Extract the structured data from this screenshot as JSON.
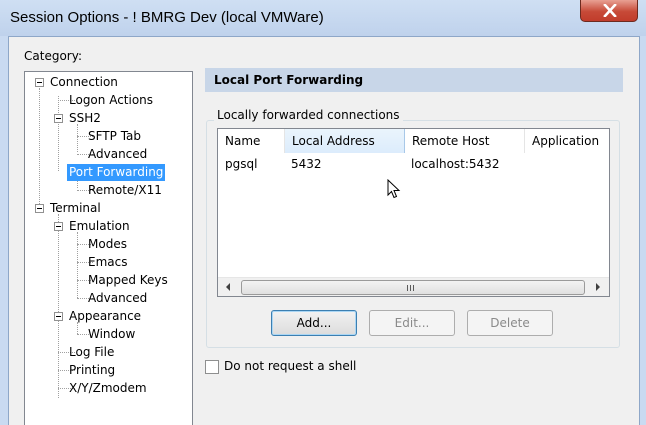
{
  "window": {
    "title": "Session Options - ! BMRG Dev (local VMWare)",
    "close_icon": "close-icon"
  },
  "category": {
    "label": "Category:",
    "tree": [
      {
        "label": "Connection",
        "level": 0
      },
      {
        "label": "Logon Actions",
        "level": 1
      },
      {
        "label": "SSH2",
        "level": 1
      },
      {
        "label": "SFTP Tab",
        "level": 2
      },
      {
        "label": "Advanced",
        "level": 2
      },
      {
        "label": "Port Forwarding",
        "level": 1,
        "selected": true
      },
      {
        "label": "Remote/X11",
        "level": 2
      },
      {
        "label": "Terminal",
        "level": 0
      },
      {
        "label": "Emulation",
        "level": 1
      },
      {
        "label": "Modes",
        "level": 2
      },
      {
        "label": "Emacs",
        "level": 2
      },
      {
        "label": "Mapped Keys",
        "level": 2
      },
      {
        "label": "Advanced",
        "level": 2
      },
      {
        "label": "Appearance",
        "level": 1
      },
      {
        "label": "Window",
        "level": 2
      },
      {
        "label": "Log File",
        "level": 1
      },
      {
        "label": "Printing",
        "level": 1
      },
      {
        "label": "X/Y/Zmodem",
        "level": 1
      }
    ]
  },
  "panel": {
    "header": "Local Port Forwarding",
    "group_label": "Locally forwarded connections",
    "columns": [
      "Name",
      "Local Address",
      "Remote Host",
      "Application"
    ],
    "rows": [
      [
        "pgsql",
        "5432",
        "localhost:5432",
        ""
      ]
    ],
    "buttons": {
      "add": "Add...",
      "edit": "Edit...",
      "delete": "Delete"
    },
    "checkbox": {
      "label": "Do not request a shell",
      "checked": false
    }
  },
  "colors": {
    "selection": "#3399ff",
    "header_band": "#c8d6e8",
    "close_button": "#c74a38"
  }
}
